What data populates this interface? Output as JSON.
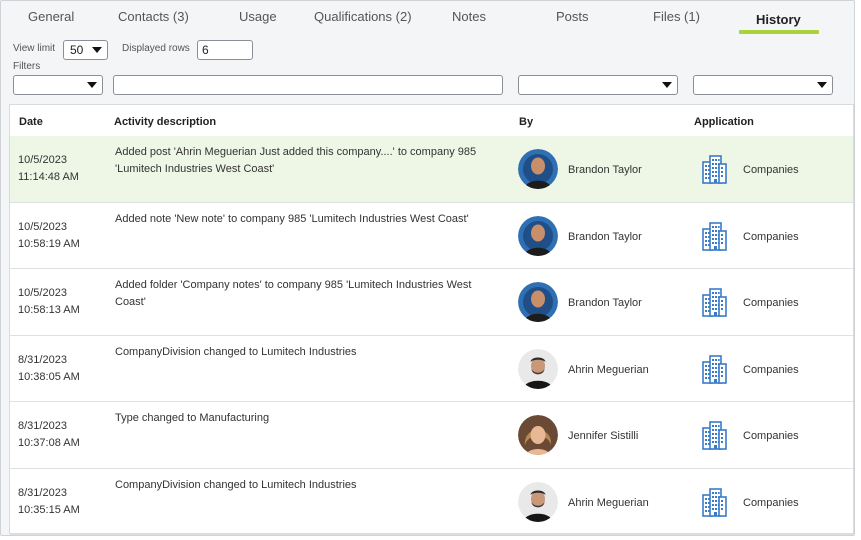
{
  "tabs": [
    {
      "label": "General"
    },
    {
      "label": "Contacts (3)"
    },
    {
      "label": "Usage"
    },
    {
      "label": "Qualifications (2)"
    },
    {
      "label": "Notes"
    },
    {
      "label": "Posts"
    },
    {
      "label": "Files (1)"
    },
    {
      "label": "History",
      "active": true
    }
  ],
  "controls": {
    "view_limit_label": "View limit",
    "view_limit_value": "50",
    "displayed_rows_label": "Displayed rows",
    "displayed_rows_value": "6",
    "filters_label": "Filters"
  },
  "table": {
    "headers": {
      "date": "Date",
      "description": "Activity description",
      "by": "By",
      "application": "Application"
    },
    "rows": [
      {
        "date": "10/5/2023",
        "time": "11:14:48 AM",
        "description": "Added post 'Ahrin Meguerian Just added this company....' to company 985 'Lumitech Industries West Coast'",
        "by": "Brandon Taylor",
        "avatar": "brandon-taylor-avatar",
        "application": "Companies",
        "highlighted": true
      },
      {
        "date": "10/5/2023",
        "time": "10:58:19 AM",
        "description": "Added note 'New note' to company 985 'Lumitech Industries West Coast'",
        "by": "Brandon Taylor",
        "avatar": "brandon-taylor-avatar",
        "application": "Companies"
      },
      {
        "date": "10/5/2023",
        "time": "10:58:13 AM",
        "description": "Added folder 'Company notes' to company 985 'Lumitech Industries West Coast'",
        "by": "Brandon Taylor",
        "avatar": "brandon-taylor-avatar",
        "application": "Companies"
      },
      {
        "date": "8/31/2023",
        "time": "10:38:05 AM",
        "description": "CompanyDivision changed to Lumitech Industries",
        "by": "Ahrin Meguerian",
        "avatar": "ahrin-meguerian-avatar",
        "application": "Companies"
      },
      {
        "date": "8/31/2023",
        "time": "10:37:08 AM",
        "description": "Type changed to Manufacturing",
        "by": "Jennifer Sistilli",
        "avatar": "jennifer-sistilli-avatar",
        "application": "Companies"
      },
      {
        "date": "8/31/2023",
        "time": "10:35:15 AM",
        "description": "CompanyDivision changed to Lumitech Industries",
        "by": "Ahrin Meguerian",
        "avatar": "ahrin-meguerian-avatar",
        "application": "Companies"
      }
    ]
  },
  "colors": {
    "active_tab_underline": "#a8d43a",
    "highlight_row": "#eef6e6",
    "building_icon": "#3a7bc8"
  }
}
